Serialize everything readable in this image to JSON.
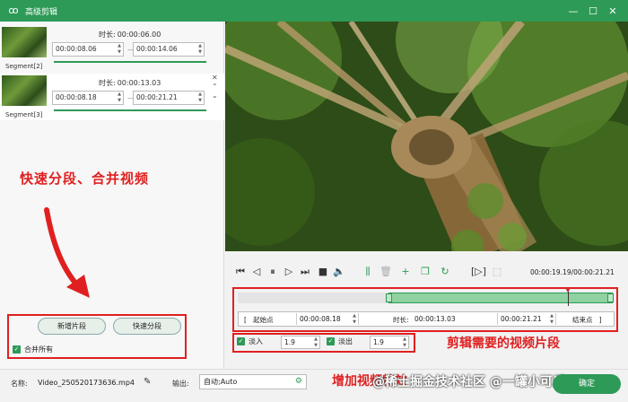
{
  "window": {
    "title": "高级剪辑",
    "minimize": "—",
    "maximize": "☐",
    "close": "✕"
  },
  "segments": [
    {
      "label": "Segment[2]",
      "duration_label": "时长:",
      "duration": "00:00:06.00",
      "start": "00:00:08.06",
      "end": "00:00:14.06",
      "separator": "—"
    },
    {
      "label": "Segment[3]",
      "duration_label": "时长:",
      "duration": "00:00:13.03",
      "start": "00:00:08.18",
      "end": "00:00:21.21",
      "separator": "—"
    }
  ],
  "left_annotation": "快速分段、合并视频",
  "left_buttons": {
    "new_segment": "新增片段",
    "quick_split": "快速分段",
    "merge_all": "合并所有"
  },
  "player": {
    "time_readout": "00:00:19.19/00:00:21.21"
  },
  "trim": {
    "start_label": "起始点",
    "start_value": "00:00:08.18",
    "duration_label": "时长:",
    "duration_value": "00:00:13.03",
    "end_value": "00:00:21.21",
    "end_label": "结束点"
  },
  "fade": {
    "fade_in_label": "淡入",
    "fade_in_value": "1.9",
    "fade_out_label": "淡出",
    "fade_out_value": "1.9"
  },
  "right_annotation": "剪辑需要的视频片段",
  "bottom": {
    "name_label": "名称:",
    "name_value": "Video_250520173636.mp4",
    "output_label": "输出:",
    "output_value": "自动;Auto",
    "annotation": "增加视频特效",
    "watermark": "@稀土掘金技术社区 @一罐小可乐",
    "ok_label": "确定"
  },
  "colors": {
    "accent": "#2e9a57",
    "annotation": "#e02020"
  }
}
